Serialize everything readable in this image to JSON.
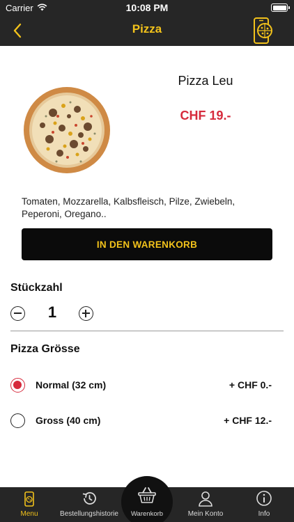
{
  "status_bar": {
    "carrier": "Carrier",
    "time": "10:08 PM"
  },
  "navbar": {
    "title": "Pizza",
    "accent_color": "#f2c21b",
    "back_icon": "chevron-left-icon",
    "right_icon": "phone-pizza-icon"
  },
  "product": {
    "name": "Pizza Leu",
    "price": "CHF 19.-",
    "price_color": "#d62a3c",
    "image": "pizza-icon",
    "description": "Tomaten, Mozzarella, Kalbsfleisch, Pilze, Zwiebeln, Peperoni, Oregano.."
  },
  "cart_button": {
    "label": "IN DEN WARENKORB"
  },
  "quantity": {
    "label": "Stückzahl",
    "value": "1"
  },
  "size": {
    "label": "Pizza Grösse",
    "options": [
      {
        "name": "Normal (32 cm)",
        "price": "+ CHF 0.-",
        "selected": true
      },
      {
        "name": "Gross (40 cm)",
        "price": "+ CHF 12.-",
        "selected": false
      }
    ]
  },
  "tabbar": {
    "items": [
      {
        "label": "Menu",
        "icon": "phone-pizza-icon",
        "active": true
      },
      {
        "label": "Bestellungshistorie",
        "icon": "history-icon",
        "active": false
      },
      {
        "label": "Warenkorb",
        "icon": "basket-icon",
        "active": false
      },
      {
        "label": "Mein Konto",
        "icon": "user-icon",
        "active": false
      },
      {
        "label": "Info",
        "icon": "info-icon",
        "active": false
      }
    ]
  }
}
